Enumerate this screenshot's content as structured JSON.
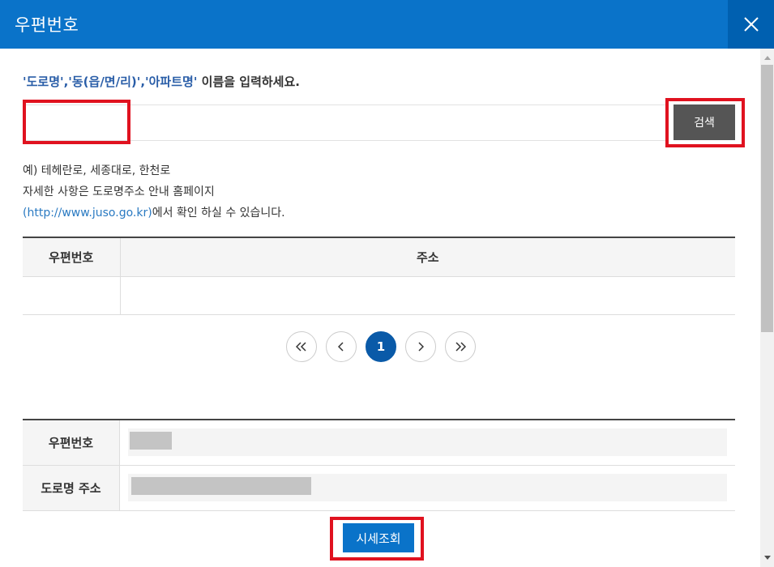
{
  "header": {
    "title": "우편번호"
  },
  "instruction": {
    "highlight": "'도로명','동(읍/면/리)','아파트명'",
    "rest": " 이름을 입력하세요."
  },
  "search": {
    "value": "",
    "button_label": "검색"
  },
  "example": {
    "line1": "예) 테헤란로, 세종대로, 한천로",
    "line2": "자세한 사항은 도로명주소 안내 홈페이지",
    "link": "(http://www.juso.go.kr)",
    "line3_rest": "에서 확인 하실 수 있습니다."
  },
  "results_table": {
    "headers": [
      "우편번호",
      "주소"
    ],
    "rows": [
      [
        "",
        ""
      ]
    ]
  },
  "pagination": {
    "first_icon": "double-chevron-left-icon",
    "prev_icon": "chevron-left-icon",
    "current": "1",
    "next_icon": "chevron-right-icon",
    "last_icon": "double-chevron-right-icon"
  },
  "detail": {
    "postal_label": "우편번호",
    "address_label": "도로명 주소"
  },
  "lookup_button": "시세조회",
  "colors": {
    "header": "#0a73c9",
    "accent": "#0a5aa8",
    "highlight": "#e0121f"
  }
}
